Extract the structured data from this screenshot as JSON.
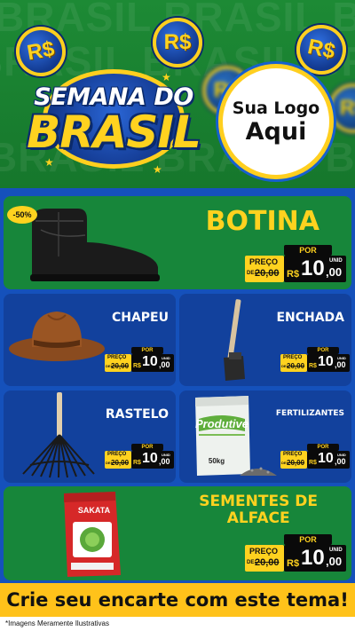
{
  "header": {
    "background_words": [
      "BRASIL BRASIL BRASIL",
      "BRASIL BRASIL BRASIL",
      "BRASIL BRASIL BRASIL"
    ],
    "coin_symbol": "R$",
    "title_line1": "SEMANA DO",
    "title_line2": "BRASIL",
    "logo_line1": "Sua Logo",
    "logo_line2": "Aqui"
  },
  "discount_badge": "-50%",
  "price_tag": {
    "por": "POR",
    "preco": "PREÇO",
    "de": "DE:",
    "old": "20,00",
    "rs": "R$",
    "new": "10",
    "cents": ",00",
    "unid": "UNID"
  },
  "products": [
    {
      "name": "BOTINA",
      "icon": "boot-icon"
    },
    {
      "name": "CHAPEU",
      "icon": "hat-icon"
    },
    {
      "name": "ENCHADA",
      "icon": "hoe-icon"
    },
    {
      "name": "RASTELO",
      "icon": "rake-icon"
    },
    {
      "name": "FERTILIZANTES",
      "icon": "fertilizer-bag-icon",
      "bag_brand": "Produtive",
      "bag_weight": "50kg"
    },
    {
      "name_line1": "SEMENTES DE",
      "name_line2": "ALFACE",
      "icon": "seed-packet-icon",
      "packet_brand": "SAKATA"
    }
  ],
  "footer": {
    "cta": "Crie seu encarte com este tema!",
    "note": "*Imagens Meramente Ilustrativas"
  },
  "colors": {
    "green": "#17863a",
    "blue": "#12419d",
    "yellow": "#ffd21f",
    "cta": "#ffc21a"
  }
}
